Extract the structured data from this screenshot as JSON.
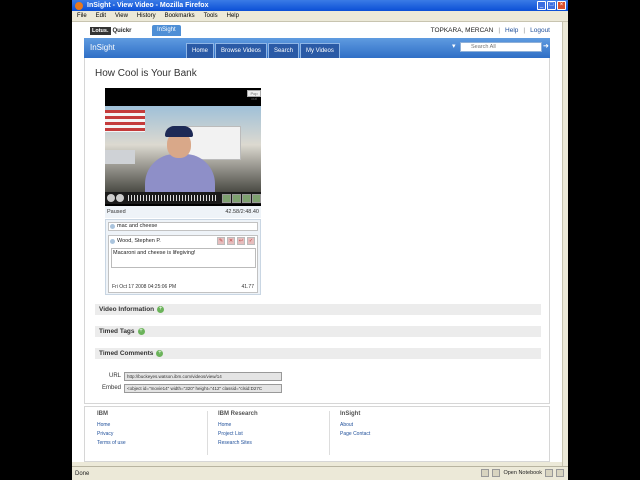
{
  "window": {
    "title": "InSight - View Video - Mozilla Firefox",
    "menu": [
      "File",
      "Edit",
      "View",
      "History",
      "Bookmarks",
      "Tools",
      "Help"
    ],
    "controls": [
      "_",
      "□",
      "×"
    ]
  },
  "topbar": {
    "brand_logo": "Lotus.",
    "brand_name": "Quickr",
    "app_tab": "InSight",
    "user": "TOPKARA, MERCAN",
    "help": "Help",
    "logout": "Logout",
    "separator": "|"
  },
  "nav": {
    "app_name": "InSight",
    "tabs": [
      "Home",
      "Browse Videos",
      "Search",
      "My Videos"
    ],
    "search_placeholder": "Search All"
  },
  "page": {
    "title": "How Cool is Your Bank"
  },
  "player": {
    "popout": "Pop out",
    "status": "Paused",
    "time": "42.58/2:48.40"
  },
  "comments": {
    "tag_text": "mac and cheese",
    "author": "Wood, Stephen P.",
    "text": "Macaroni and cheese is lifegiving!",
    "date": "Fri Oct 17 2008 04:25:06 PM",
    "timestamp": "41.77"
  },
  "sections": {
    "video_info": "Video Information",
    "timed_tags": "Timed Tags",
    "timed_comments": "Timed Comments",
    "plus": "+"
  },
  "share": {
    "url_label": "URL",
    "url_value": "http://buckeyes.watson.ibm.com/videos/view/14",
    "embed_label": "Embed",
    "embed_value": "<object id=\"movie14\" width=\"320\" height=\"412\" classid=\"clsid:D27C"
  },
  "footer": {
    "col1": {
      "heading": "IBM",
      "links": [
        "Home",
        "Privacy",
        "Terms of use"
      ]
    },
    "col2": {
      "heading": "IBM Research",
      "links": [
        "Home",
        "Project List",
        "Research Sites"
      ]
    },
    "col3": {
      "heading": "InSight",
      "links": [
        "About",
        "Page Contact"
      ]
    }
  },
  "statusbar": {
    "text": "Done",
    "notebook": "Open Notebook"
  }
}
